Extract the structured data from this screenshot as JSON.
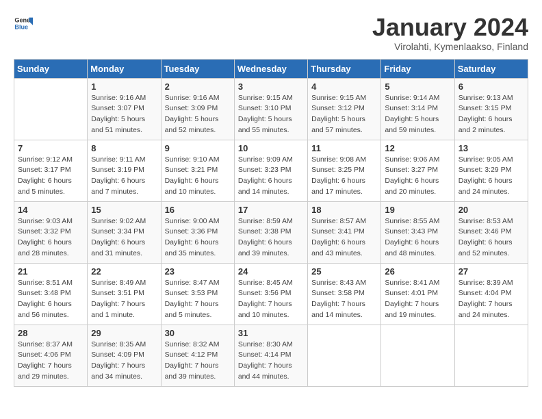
{
  "header": {
    "logo_general": "General",
    "logo_blue": "Blue",
    "title": "January 2024",
    "location": "Virolahti, Kymenlaakso, Finland"
  },
  "weekdays": [
    "Sunday",
    "Monday",
    "Tuesday",
    "Wednesday",
    "Thursday",
    "Friday",
    "Saturday"
  ],
  "weeks": [
    [
      {
        "day": "",
        "info": ""
      },
      {
        "day": "1",
        "info": "Sunrise: 9:16 AM\nSunset: 3:07 PM\nDaylight: 5 hours\nand 51 minutes."
      },
      {
        "day": "2",
        "info": "Sunrise: 9:16 AM\nSunset: 3:09 PM\nDaylight: 5 hours\nand 52 minutes."
      },
      {
        "day": "3",
        "info": "Sunrise: 9:15 AM\nSunset: 3:10 PM\nDaylight: 5 hours\nand 55 minutes."
      },
      {
        "day": "4",
        "info": "Sunrise: 9:15 AM\nSunset: 3:12 PM\nDaylight: 5 hours\nand 57 minutes."
      },
      {
        "day": "5",
        "info": "Sunrise: 9:14 AM\nSunset: 3:14 PM\nDaylight: 5 hours\nand 59 minutes."
      },
      {
        "day": "6",
        "info": "Sunrise: 9:13 AM\nSunset: 3:15 PM\nDaylight: 6 hours\nand 2 minutes."
      }
    ],
    [
      {
        "day": "7",
        "info": "Sunrise: 9:12 AM\nSunset: 3:17 PM\nDaylight: 6 hours\nand 5 minutes."
      },
      {
        "day": "8",
        "info": "Sunrise: 9:11 AM\nSunset: 3:19 PM\nDaylight: 6 hours\nand 7 minutes."
      },
      {
        "day": "9",
        "info": "Sunrise: 9:10 AM\nSunset: 3:21 PM\nDaylight: 6 hours\nand 10 minutes."
      },
      {
        "day": "10",
        "info": "Sunrise: 9:09 AM\nSunset: 3:23 PM\nDaylight: 6 hours\nand 14 minutes."
      },
      {
        "day": "11",
        "info": "Sunrise: 9:08 AM\nSunset: 3:25 PM\nDaylight: 6 hours\nand 17 minutes."
      },
      {
        "day": "12",
        "info": "Sunrise: 9:06 AM\nSunset: 3:27 PM\nDaylight: 6 hours\nand 20 minutes."
      },
      {
        "day": "13",
        "info": "Sunrise: 9:05 AM\nSunset: 3:29 PM\nDaylight: 6 hours\nand 24 minutes."
      }
    ],
    [
      {
        "day": "14",
        "info": "Sunrise: 9:03 AM\nSunset: 3:32 PM\nDaylight: 6 hours\nand 28 minutes."
      },
      {
        "day": "15",
        "info": "Sunrise: 9:02 AM\nSunset: 3:34 PM\nDaylight: 6 hours\nand 31 minutes."
      },
      {
        "day": "16",
        "info": "Sunrise: 9:00 AM\nSunset: 3:36 PM\nDaylight: 6 hours\nand 35 minutes."
      },
      {
        "day": "17",
        "info": "Sunrise: 8:59 AM\nSunset: 3:38 PM\nDaylight: 6 hours\nand 39 minutes."
      },
      {
        "day": "18",
        "info": "Sunrise: 8:57 AM\nSunset: 3:41 PM\nDaylight: 6 hours\nand 43 minutes."
      },
      {
        "day": "19",
        "info": "Sunrise: 8:55 AM\nSunset: 3:43 PM\nDaylight: 6 hours\nand 48 minutes."
      },
      {
        "day": "20",
        "info": "Sunrise: 8:53 AM\nSunset: 3:46 PM\nDaylight: 6 hours\nand 52 minutes."
      }
    ],
    [
      {
        "day": "21",
        "info": "Sunrise: 8:51 AM\nSunset: 3:48 PM\nDaylight: 6 hours\nand 56 minutes."
      },
      {
        "day": "22",
        "info": "Sunrise: 8:49 AM\nSunset: 3:51 PM\nDaylight: 7 hours\nand 1 minute."
      },
      {
        "day": "23",
        "info": "Sunrise: 8:47 AM\nSunset: 3:53 PM\nDaylight: 7 hours\nand 5 minutes."
      },
      {
        "day": "24",
        "info": "Sunrise: 8:45 AM\nSunset: 3:56 PM\nDaylight: 7 hours\nand 10 minutes."
      },
      {
        "day": "25",
        "info": "Sunrise: 8:43 AM\nSunset: 3:58 PM\nDaylight: 7 hours\nand 14 minutes."
      },
      {
        "day": "26",
        "info": "Sunrise: 8:41 AM\nSunset: 4:01 PM\nDaylight: 7 hours\nand 19 minutes."
      },
      {
        "day": "27",
        "info": "Sunrise: 8:39 AM\nSunset: 4:04 PM\nDaylight: 7 hours\nand 24 minutes."
      }
    ],
    [
      {
        "day": "28",
        "info": "Sunrise: 8:37 AM\nSunset: 4:06 PM\nDaylight: 7 hours\nand 29 minutes."
      },
      {
        "day": "29",
        "info": "Sunrise: 8:35 AM\nSunset: 4:09 PM\nDaylight: 7 hours\nand 34 minutes."
      },
      {
        "day": "30",
        "info": "Sunrise: 8:32 AM\nSunset: 4:12 PM\nDaylight: 7 hours\nand 39 minutes."
      },
      {
        "day": "31",
        "info": "Sunrise: 8:30 AM\nSunset: 4:14 PM\nDaylight: 7 hours\nand 44 minutes."
      },
      {
        "day": "",
        "info": ""
      },
      {
        "day": "",
        "info": ""
      },
      {
        "day": "",
        "info": ""
      }
    ]
  ]
}
